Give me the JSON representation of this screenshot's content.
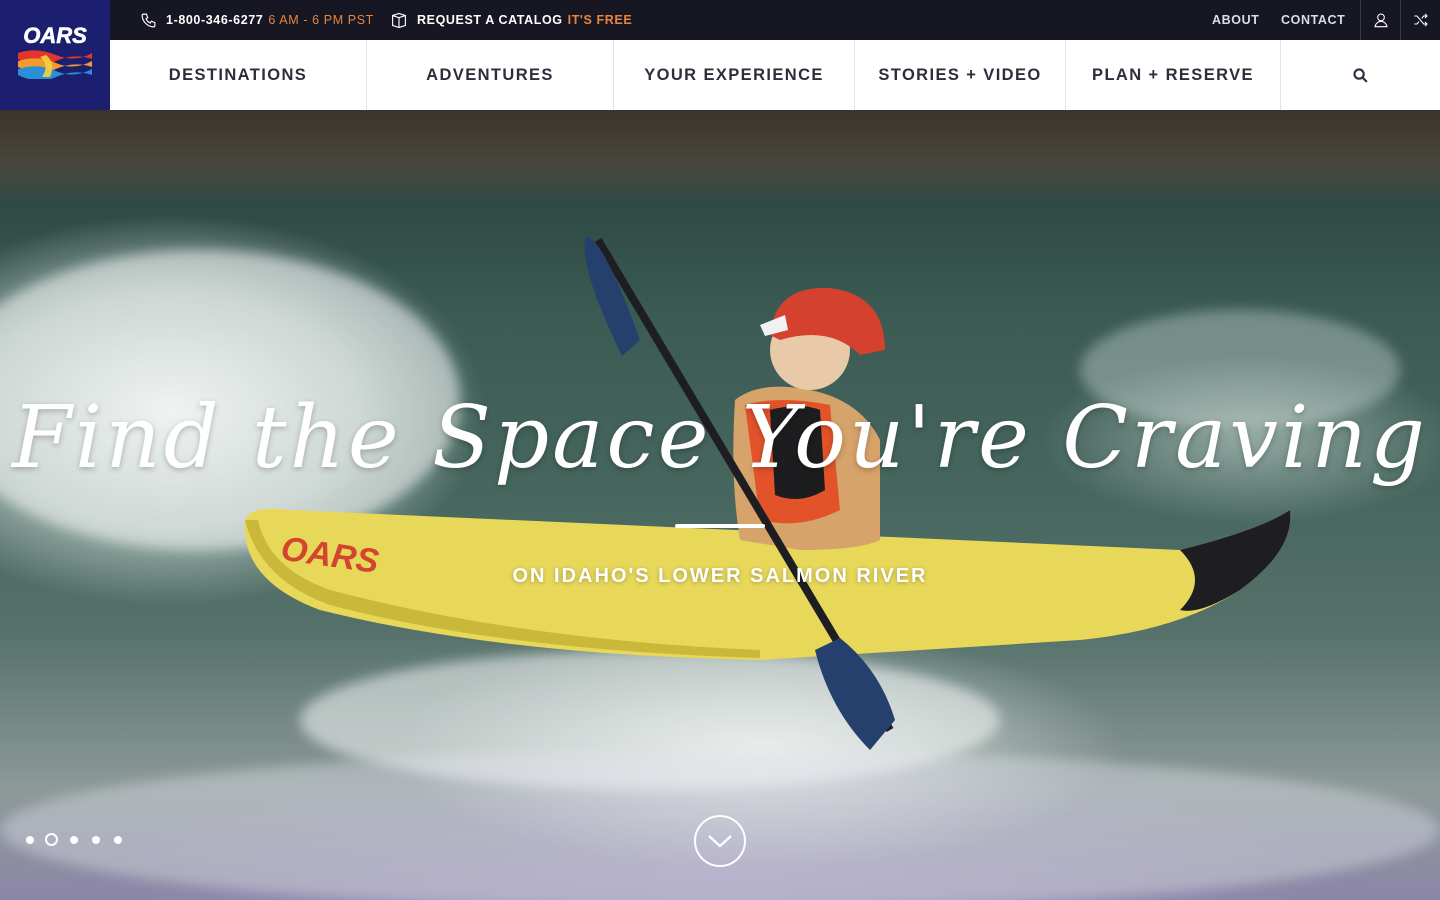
{
  "colors": {
    "brand_navy": "#1c1f70",
    "topbar_bg": "#161723",
    "accent_orange": "#e9843b",
    "nav_text": "#2c2e3b"
  },
  "brand": {
    "logo_text": "OARS"
  },
  "utility_bar": {
    "phone_icon": "phone-icon",
    "phone_number": "1-800-346-6277",
    "phone_hours": "6 AM - 6 PM PST",
    "catalog_icon": "book-icon",
    "catalog_label": "REQUEST A CATALOG",
    "catalog_note": "IT'S FREE",
    "about_label": "ABOUT",
    "contact_label": "CONTACT",
    "account_icon": "user-icon",
    "random_icon": "shuffle-icon"
  },
  "main_nav": {
    "items": [
      {
        "label": "DESTINATIONS"
      },
      {
        "label": "ADVENTURES"
      },
      {
        "label": "YOUR EXPERIENCE"
      },
      {
        "label": "STORIES + VIDEO"
      },
      {
        "label": "PLAN + RESERVE"
      }
    ],
    "search_icon": "search-icon"
  },
  "hero": {
    "title": "Find the Space You're Craving",
    "subtitle": "ON IDAHO'S LOWER SALMON RIVER",
    "kayak_text": "OARS",
    "slides": {
      "count": 5,
      "active_index": 1
    },
    "scroll_icon": "chevron-down-icon"
  }
}
